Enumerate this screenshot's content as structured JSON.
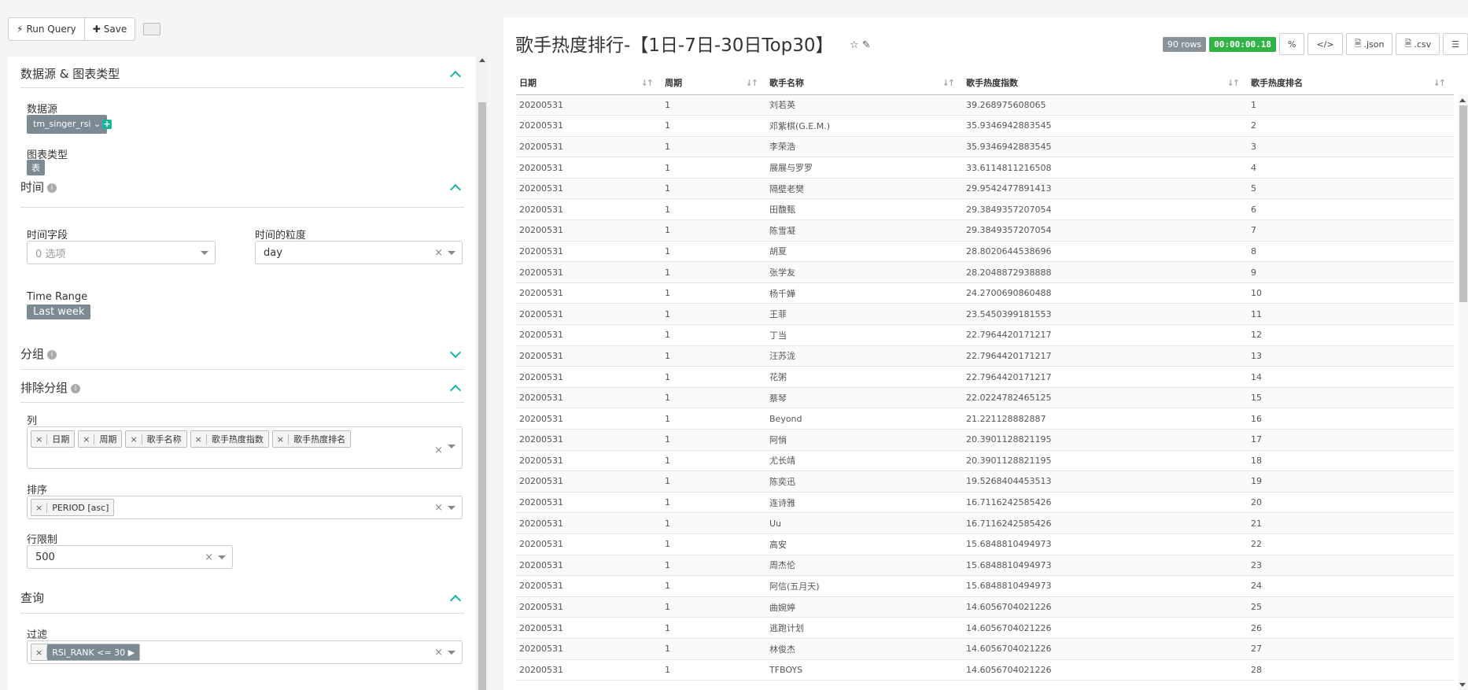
{
  "toolbar": {
    "run_query": "Run Query",
    "save": "Save"
  },
  "left": {
    "datasource_section": "数据源 & 图表类型",
    "datasource_label": "数据源",
    "datasource_value": "tm_singer_rsi",
    "viz_type_label": "图表类型",
    "viz_type_value": "表",
    "time_section": "时间",
    "time_column_label": "时间字段",
    "time_column_placeholder": "0 选项",
    "time_grain_label": "时间的粒度",
    "time_grain_value": "day",
    "time_range_label": "Time Range",
    "time_range_value": "Last week",
    "group_section": "分组",
    "nogroup_section": "排除分组",
    "columns_label": "列",
    "columns": [
      "日期",
      "周期",
      "歌手名称",
      "歌手热度指数",
      "歌手热度排名"
    ],
    "ordering_label": "排序",
    "ordering_value": "PERIOD [asc]",
    "row_limit_label": "行限制",
    "row_limit_value": "500",
    "query_section": "查询",
    "filter_label": "过滤",
    "filter_value": "RSI_RANK <= 30"
  },
  "right": {
    "title": "歌手热度排行-【1日-7日-30日Top30】",
    "rows_badge": "90 rows",
    "time_badge": "00:00:00.18",
    "json_btn": ".json",
    "csv_btn": ".csv",
    "headers": [
      "日期",
      "周期",
      "歌手名称",
      "歌手热度指数",
      "歌手热度排名"
    ],
    "rows": [
      [
        "20200531",
        "1",
        "刘若英",
        "39.268975608065",
        "1"
      ],
      [
        "20200531",
        "1",
        "邓紫棋(G.E.M.)",
        "35.9346942883545",
        "2"
      ],
      [
        "20200531",
        "1",
        "李荣浩",
        "35.9346942883545",
        "3"
      ],
      [
        "20200531",
        "1",
        "展展与罗罗",
        "33.6114811216508",
        "4"
      ],
      [
        "20200531",
        "1",
        "隔壁老樊",
        "29.9542477891413",
        "5"
      ],
      [
        "20200531",
        "1",
        "田馥甄",
        "29.3849357207054",
        "6"
      ],
      [
        "20200531",
        "1",
        "陈雪凝",
        "29.3849357207054",
        "7"
      ],
      [
        "20200531",
        "1",
        "胡夏",
        "28.8020644538696",
        "8"
      ],
      [
        "20200531",
        "1",
        "张学友",
        "28.2048872938888",
        "9"
      ],
      [
        "20200531",
        "1",
        "杨千嬅",
        "24.2700690860488",
        "10"
      ],
      [
        "20200531",
        "1",
        "王菲",
        "23.5450399181553",
        "11"
      ],
      [
        "20200531",
        "1",
        "丁当",
        "22.7964420171217",
        "12"
      ],
      [
        "20200531",
        "1",
        "汪苏泷",
        "22.7964420171217",
        "13"
      ],
      [
        "20200531",
        "1",
        "花粥",
        "22.7964420171217",
        "14"
      ],
      [
        "20200531",
        "1",
        "蔡琴",
        "22.0224782465125",
        "15"
      ],
      [
        "20200531",
        "1",
        "Beyond",
        "21.221128882887",
        "16"
      ],
      [
        "20200531",
        "1",
        "阿悄",
        "20.3901128821195",
        "17"
      ],
      [
        "20200531",
        "1",
        "尤长靖",
        "20.3901128821195",
        "18"
      ],
      [
        "20200531",
        "1",
        "陈奕迅",
        "19.5268404453513",
        "19"
      ],
      [
        "20200531",
        "1",
        "连诗雅",
        "16.7116242585426",
        "20"
      ],
      [
        "20200531",
        "1",
        "Uu",
        "16.7116242585426",
        "21"
      ],
      [
        "20200531",
        "1",
        "高安",
        "15.6848810494973",
        "22"
      ],
      [
        "20200531",
        "1",
        "周杰伦",
        "15.6848810494973",
        "23"
      ],
      [
        "20200531",
        "1",
        "阿信(五月天)",
        "15.6848810494973",
        "24"
      ],
      [
        "20200531",
        "1",
        "曲婉婷",
        "14.6056704021226",
        "25"
      ],
      [
        "20200531",
        "1",
        "逃跑计划",
        "14.6056704021226",
        "26"
      ],
      [
        "20200531",
        "1",
        "林俊杰",
        "14.6056704021226",
        "27"
      ],
      [
        "20200531",
        "1",
        "TFBOYS",
        "14.6056704021226",
        "28"
      ]
    ]
  }
}
